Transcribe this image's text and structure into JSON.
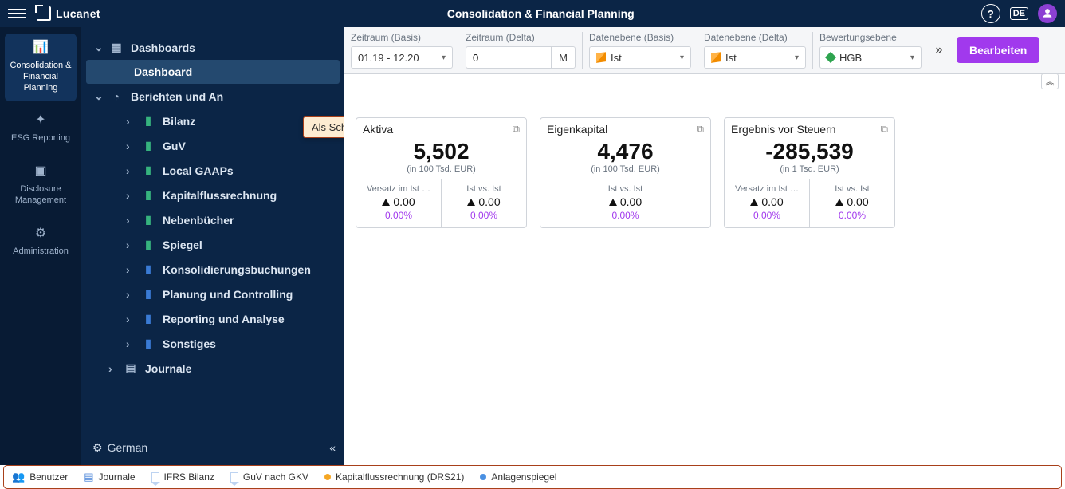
{
  "top": {
    "brand": "Lucanet",
    "title": "Consolidation & Financial Planning",
    "lang": "DE"
  },
  "rail": [
    {
      "label": "Consolidation & Financial Planning",
      "active": true
    },
    {
      "label": "ESG Reporting",
      "active": false
    },
    {
      "label": "Disclosure Management",
      "active": false
    },
    {
      "label": "Administration",
      "active": false
    }
  ],
  "tree": {
    "dashboards": "Dashboards",
    "dashboard_item": "Dashboard",
    "reports": "Berichten und An",
    "reports_children": [
      {
        "label": "Bilanz",
        "color": "green"
      },
      {
        "label": "GuV",
        "color": "green"
      },
      {
        "label": "Local GAAPs",
        "color": "green"
      },
      {
        "label": "Kapitalflussrechnung",
        "color": "green"
      },
      {
        "label": "Nebenbücher",
        "color": "green"
      },
      {
        "label": "Spiegel",
        "color": "green"
      },
      {
        "label": "Konsolidierungsbuchungen",
        "color": "blue"
      },
      {
        "label": "Planung und Controlling",
        "color": "blue"
      },
      {
        "label": "Reporting und Analyse",
        "color": "blue"
      },
      {
        "label": "Sonstiges",
        "color": "blue"
      }
    ],
    "journals": "Journale",
    "footer_lang": "German"
  },
  "tooltip": "Als Schnellzugriff hinzufügen",
  "filters": {
    "period_basis_lbl": "Zeitraum (Basis)",
    "period_basis_val": "01.19 - 12.20",
    "period_delta_lbl": "Zeitraum (Delta)",
    "period_delta_val": "0",
    "period_delta_suffix": "M",
    "layer_basis_lbl": "Datenebene (Basis)",
    "layer_basis_val": "Ist",
    "layer_delta_lbl": "Datenebene (Delta)",
    "layer_delta_val": "Ist",
    "valuation_lbl": "Bewertungsebene",
    "valuation_val": "HGB",
    "edit": "Bearbeiten"
  },
  "cards": [
    {
      "title": "Aktiva",
      "big": "5,502",
      "sub": "(in 100 Tsd. EUR)",
      "metrics": [
        {
          "lbl": "Versatz im Ist …",
          "val": "0.00",
          "pct": "0.00%"
        },
        {
          "lbl": "Ist vs. Ist",
          "val": "0.00",
          "pct": "0.00%"
        }
      ]
    },
    {
      "title": "Eigenkapital",
      "big": "4,476",
      "sub": "(in 100 Tsd. EUR)",
      "metrics": [
        {
          "lbl": "Ist vs. Ist",
          "val": "0.00",
          "pct": "0.00%"
        }
      ]
    },
    {
      "title": "Ergebnis vor Steuern",
      "big": "-285,539",
      "sub": "(in 1 Tsd. EUR)",
      "metrics": [
        {
          "lbl": "Versatz im Ist …",
          "val": "0.00",
          "pct": "0.00%"
        },
        {
          "lbl": "Ist vs. Ist",
          "val": "0.00",
          "pct": "0.00%"
        }
      ]
    }
  ],
  "status": [
    {
      "icon": "users",
      "label": "Benutzer"
    },
    {
      "icon": "doc",
      "label": "Journale"
    },
    {
      "icon": "bm",
      "label": "IFRS Bilanz"
    },
    {
      "icon": "bm",
      "label": "GuV nach GKV"
    },
    {
      "icon": "dot-orange",
      "label": "Kapitalflussrechnung (DRS21)"
    },
    {
      "icon": "dot-blue",
      "label": "Anlagenspiegel"
    }
  ]
}
